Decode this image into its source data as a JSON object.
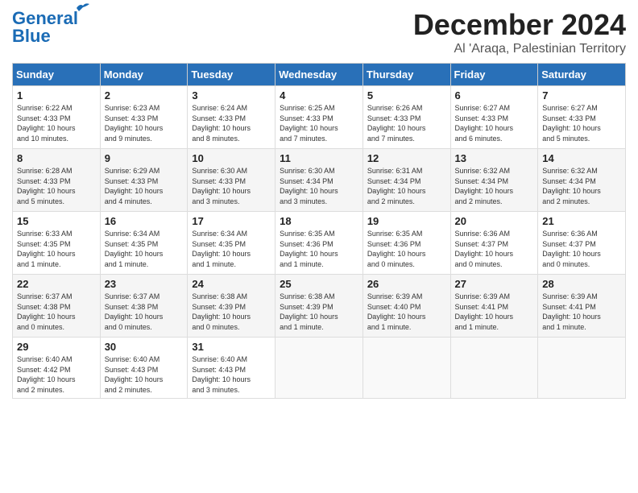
{
  "header": {
    "logo_line1": "General",
    "logo_line2": "Blue",
    "month": "December 2024",
    "location": "Al 'Araqa, Palestinian Territory"
  },
  "days_of_week": [
    "Sunday",
    "Monday",
    "Tuesday",
    "Wednesday",
    "Thursday",
    "Friday",
    "Saturday"
  ],
  "weeks": [
    [
      {
        "day": "1",
        "details": "Sunrise: 6:22 AM\nSunset: 4:33 PM\nDaylight: 10 hours\nand 10 minutes."
      },
      {
        "day": "2",
        "details": "Sunrise: 6:23 AM\nSunset: 4:33 PM\nDaylight: 10 hours\nand 9 minutes."
      },
      {
        "day": "3",
        "details": "Sunrise: 6:24 AM\nSunset: 4:33 PM\nDaylight: 10 hours\nand 8 minutes."
      },
      {
        "day": "4",
        "details": "Sunrise: 6:25 AM\nSunset: 4:33 PM\nDaylight: 10 hours\nand 7 minutes."
      },
      {
        "day": "5",
        "details": "Sunrise: 6:26 AM\nSunset: 4:33 PM\nDaylight: 10 hours\nand 7 minutes."
      },
      {
        "day": "6",
        "details": "Sunrise: 6:27 AM\nSunset: 4:33 PM\nDaylight: 10 hours\nand 6 minutes."
      },
      {
        "day": "7",
        "details": "Sunrise: 6:27 AM\nSunset: 4:33 PM\nDaylight: 10 hours\nand 5 minutes."
      }
    ],
    [
      {
        "day": "8",
        "details": "Sunrise: 6:28 AM\nSunset: 4:33 PM\nDaylight: 10 hours\nand 5 minutes."
      },
      {
        "day": "9",
        "details": "Sunrise: 6:29 AM\nSunset: 4:33 PM\nDaylight: 10 hours\nand 4 minutes."
      },
      {
        "day": "10",
        "details": "Sunrise: 6:30 AM\nSunset: 4:33 PM\nDaylight: 10 hours\nand 3 minutes."
      },
      {
        "day": "11",
        "details": "Sunrise: 6:30 AM\nSunset: 4:34 PM\nDaylight: 10 hours\nand 3 minutes."
      },
      {
        "day": "12",
        "details": "Sunrise: 6:31 AM\nSunset: 4:34 PM\nDaylight: 10 hours\nand 2 minutes."
      },
      {
        "day": "13",
        "details": "Sunrise: 6:32 AM\nSunset: 4:34 PM\nDaylight: 10 hours\nand 2 minutes."
      },
      {
        "day": "14",
        "details": "Sunrise: 6:32 AM\nSunset: 4:34 PM\nDaylight: 10 hours\nand 2 minutes."
      }
    ],
    [
      {
        "day": "15",
        "details": "Sunrise: 6:33 AM\nSunset: 4:35 PM\nDaylight: 10 hours\nand 1 minute."
      },
      {
        "day": "16",
        "details": "Sunrise: 6:34 AM\nSunset: 4:35 PM\nDaylight: 10 hours\nand 1 minute."
      },
      {
        "day": "17",
        "details": "Sunrise: 6:34 AM\nSunset: 4:35 PM\nDaylight: 10 hours\nand 1 minute."
      },
      {
        "day": "18",
        "details": "Sunrise: 6:35 AM\nSunset: 4:36 PM\nDaylight: 10 hours\nand 1 minute."
      },
      {
        "day": "19",
        "details": "Sunrise: 6:35 AM\nSunset: 4:36 PM\nDaylight: 10 hours\nand 0 minutes."
      },
      {
        "day": "20",
        "details": "Sunrise: 6:36 AM\nSunset: 4:37 PM\nDaylight: 10 hours\nand 0 minutes."
      },
      {
        "day": "21",
        "details": "Sunrise: 6:36 AM\nSunset: 4:37 PM\nDaylight: 10 hours\nand 0 minutes."
      }
    ],
    [
      {
        "day": "22",
        "details": "Sunrise: 6:37 AM\nSunset: 4:38 PM\nDaylight: 10 hours\nand 0 minutes."
      },
      {
        "day": "23",
        "details": "Sunrise: 6:37 AM\nSunset: 4:38 PM\nDaylight: 10 hours\nand 0 minutes."
      },
      {
        "day": "24",
        "details": "Sunrise: 6:38 AM\nSunset: 4:39 PM\nDaylight: 10 hours\nand 0 minutes."
      },
      {
        "day": "25",
        "details": "Sunrise: 6:38 AM\nSunset: 4:39 PM\nDaylight: 10 hours\nand 1 minute."
      },
      {
        "day": "26",
        "details": "Sunrise: 6:39 AM\nSunset: 4:40 PM\nDaylight: 10 hours\nand 1 minute."
      },
      {
        "day": "27",
        "details": "Sunrise: 6:39 AM\nSunset: 4:41 PM\nDaylight: 10 hours\nand 1 minute."
      },
      {
        "day": "28",
        "details": "Sunrise: 6:39 AM\nSunset: 4:41 PM\nDaylight: 10 hours\nand 1 minute."
      }
    ],
    [
      {
        "day": "29",
        "details": "Sunrise: 6:40 AM\nSunset: 4:42 PM\nDaylight: 10 hours\nand 2 minutes."
      },
      {
        "day": "30",
        "details": "Sunrise: 6:40 AM\nSunset: 4:43 PM\nDaylight: 10 hours\nand 2 minutes."
      },
      {
        "day": "31",
        "details": "Sunrise: 6:40 AM\nSunset: 4:43 PM\nDaylight: 10 hours\nand 3 minutes."
      },
      {
        "day": "",
        "details": ""
      },
      {
        "day": "",
        "details": ""
      },
      {
        "day": "",
        "details": ""
      },
      {
        "day": "",
        "details": ""
      }
    ]
  ]
}
